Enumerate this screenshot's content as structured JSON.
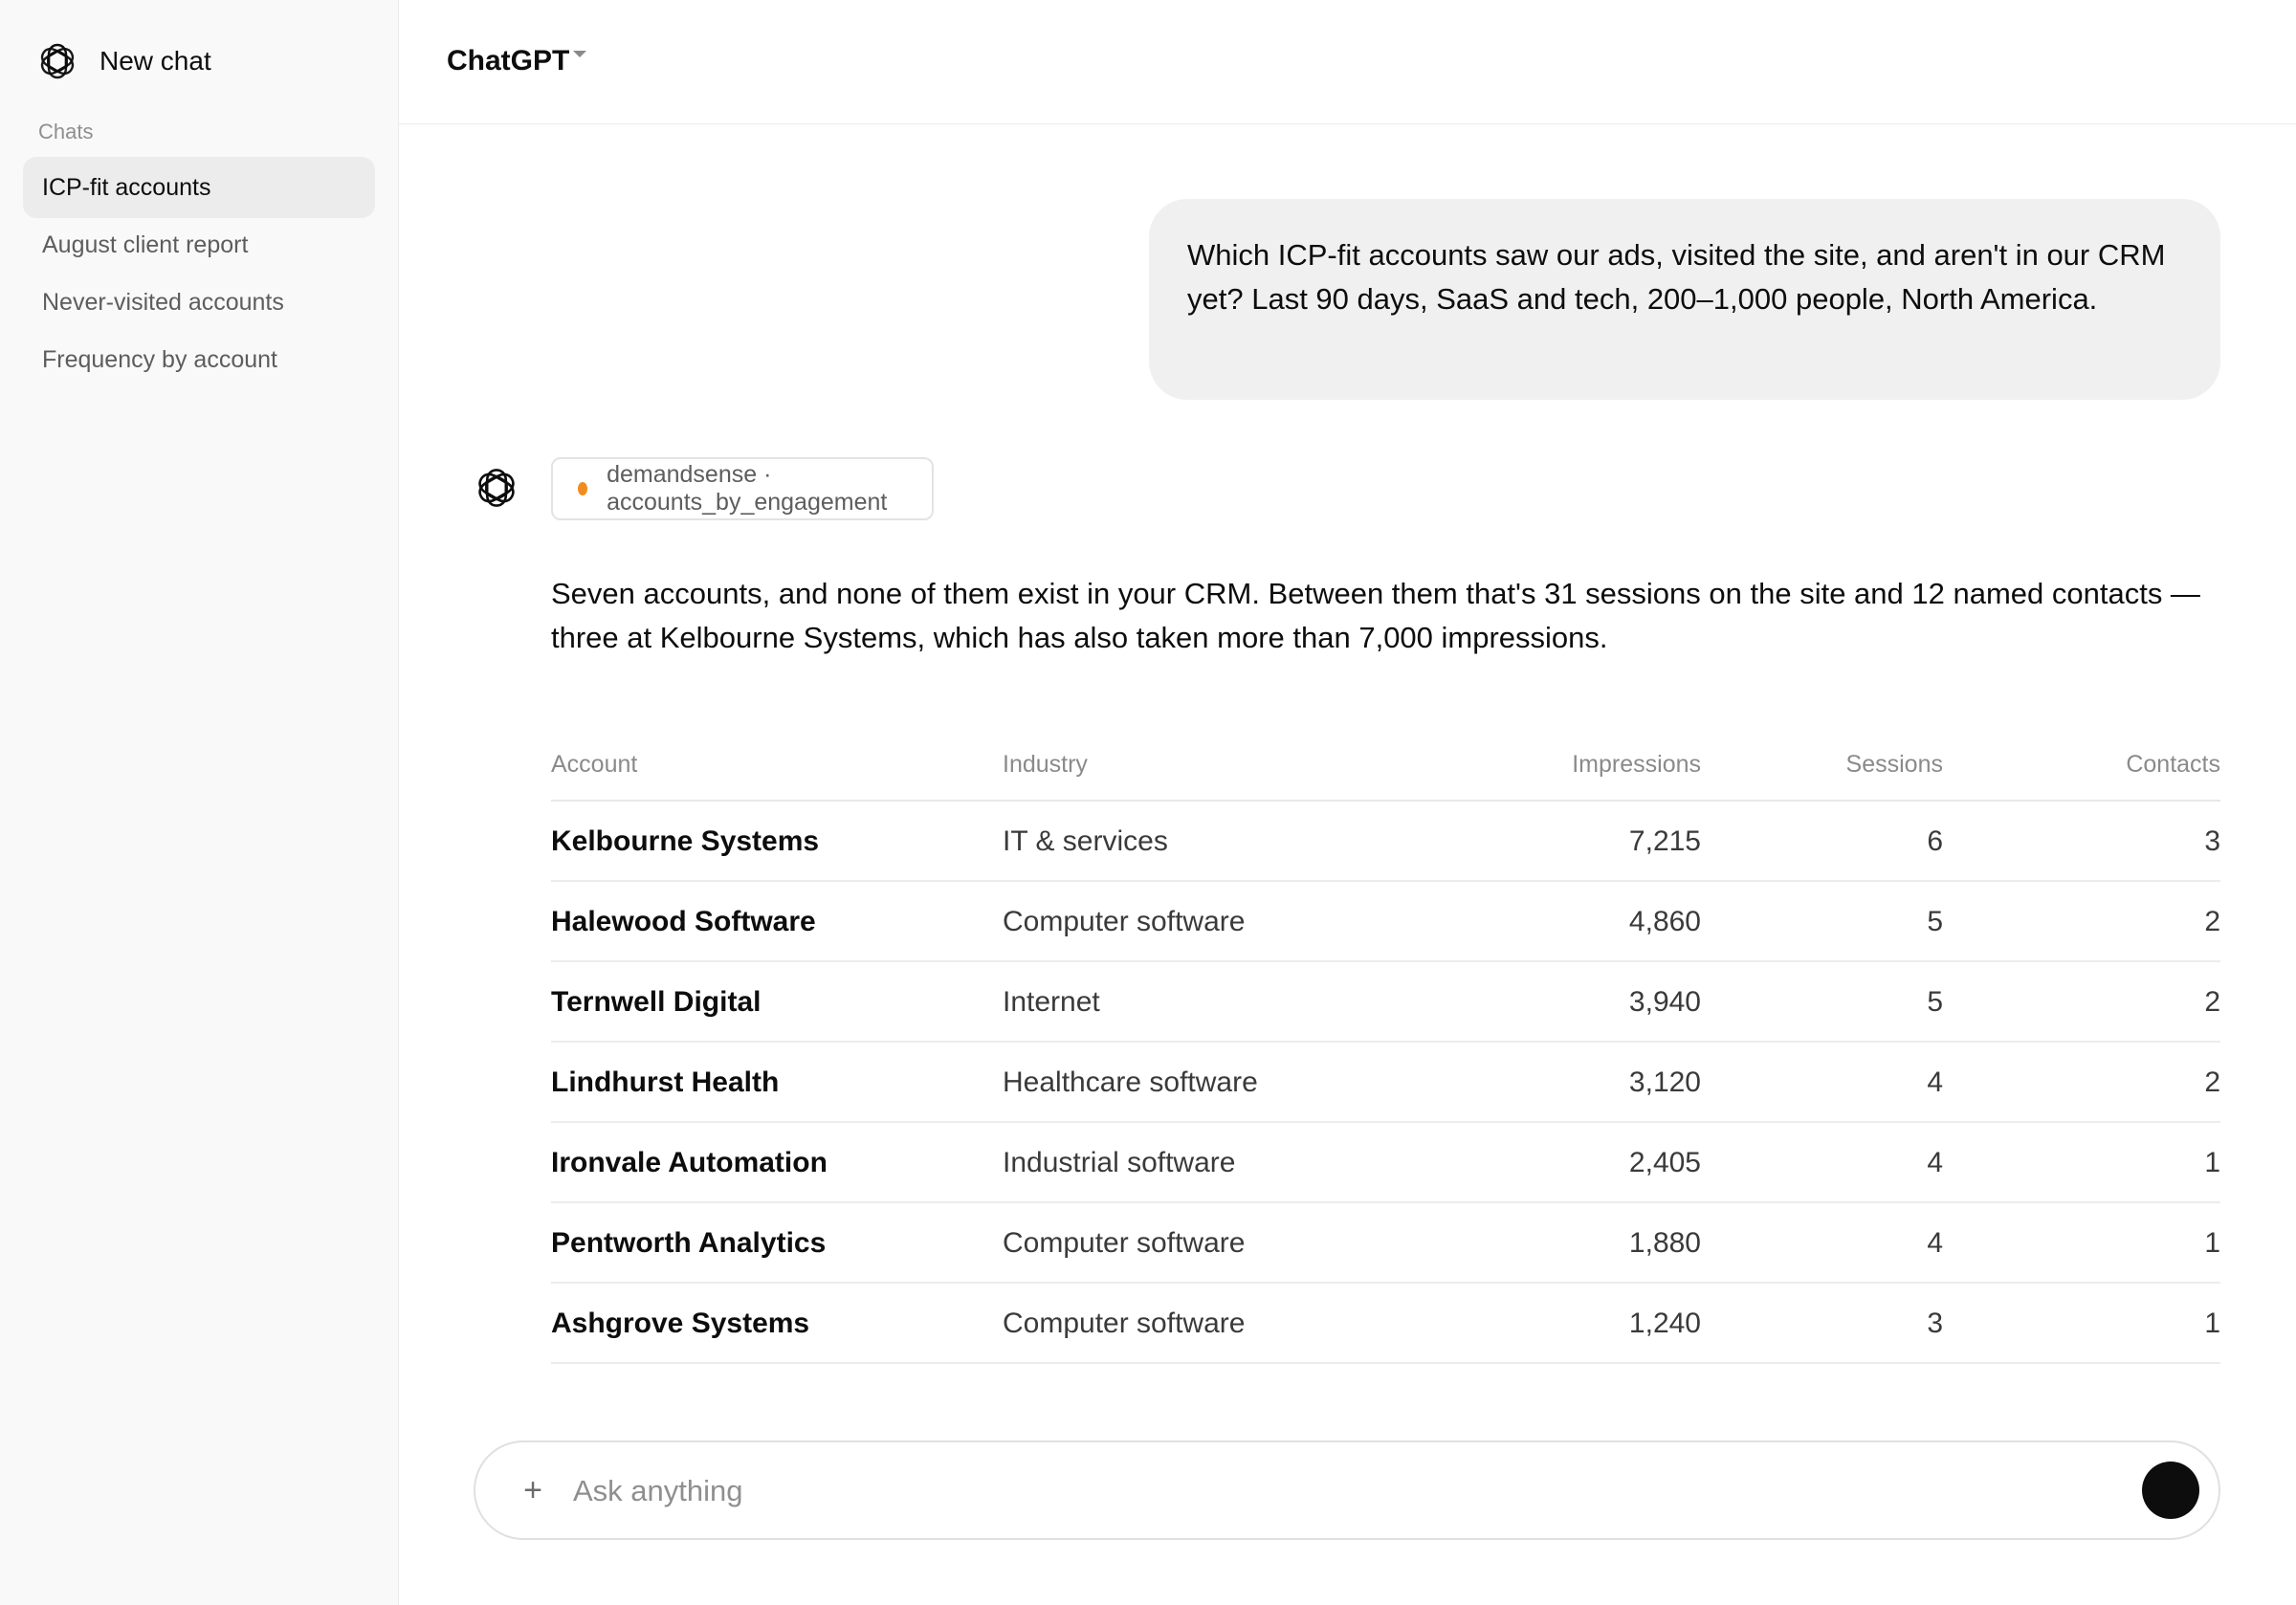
{
  "sidebar": {
    "new_chat_label": "New chat",
    "section_label": "Chats",
    "items": [
      {
        "label": "ICP-fit accounts",
        "active": true
      },
      {
        "label": "August client report",
        "active": false
      },
      {
        "label": "Never-visited accounts",
        "active": false
      },
      {
        "label": "Frequency by account",
        "active": false
      }
    ]
  },
  "header": {
    "model_name": "ChatGPT"
  },
  "conversation": {
    "user_message": "Which ICP-fit accounts saw our ads, visited the site, and aren't in our CRM yet? Last 90 days, SaaS and tech, 200–1,000 people, North America.",
    "tool_call": {
      "label": "demandsense · accounts_by_engagement",
      "status_color": "#f28c1e"
    },
    "assistant_text": "Seven accounts, and none of them exist in your CRM. Between them that's 31 sessions on the site and 12 named contacts — three at Kelbourne Systems, which has also taken more than 7,000 impressions."
  },
  "table": {
    "columns": [
      "Account",
      "Industry",
      "Impressions",
      "Sessions",
      "Contacts"
    ],
    "rows": [
      [
        "Kelbourne Systems",
        "IT & services",
        "7,215",
        "6",
        "3"
      ],
      [
        "Halewood Software",
        "Computer software",
        "4,860",
        "5",
        "2"
      ],
      [
        "Ternwell Digital",
        "Internet",
        "3,940",
        "5",
        "2"
      ],
      [
        "Lindhurst Health",
        "Healthcare software",
        "3,120",
        "4",
        "2"
      ],
      [
        "Ironvale Automation",
        "Industrial software",
        "2,405",
        "4",
        "1"
      ],
      [
        "Pentworth Analytics",
        "Computer software",
        "1,880",
        "4",
        "1"
      ],
      [
        "Ashgrove Systems",
        "Computer software",
        "1,240",
        "3",
        "1"
      ]
    ]
  },
  "composer": {
    "plus_label": "+",
    "placeholder": "Ask anything"
  },
  "icons": {
    "logo": "openai-logo-icon",
    "plus": "plus-icon",
    "send": "send-icon",
    "caret": "chevron-down-icon"
  }
}
